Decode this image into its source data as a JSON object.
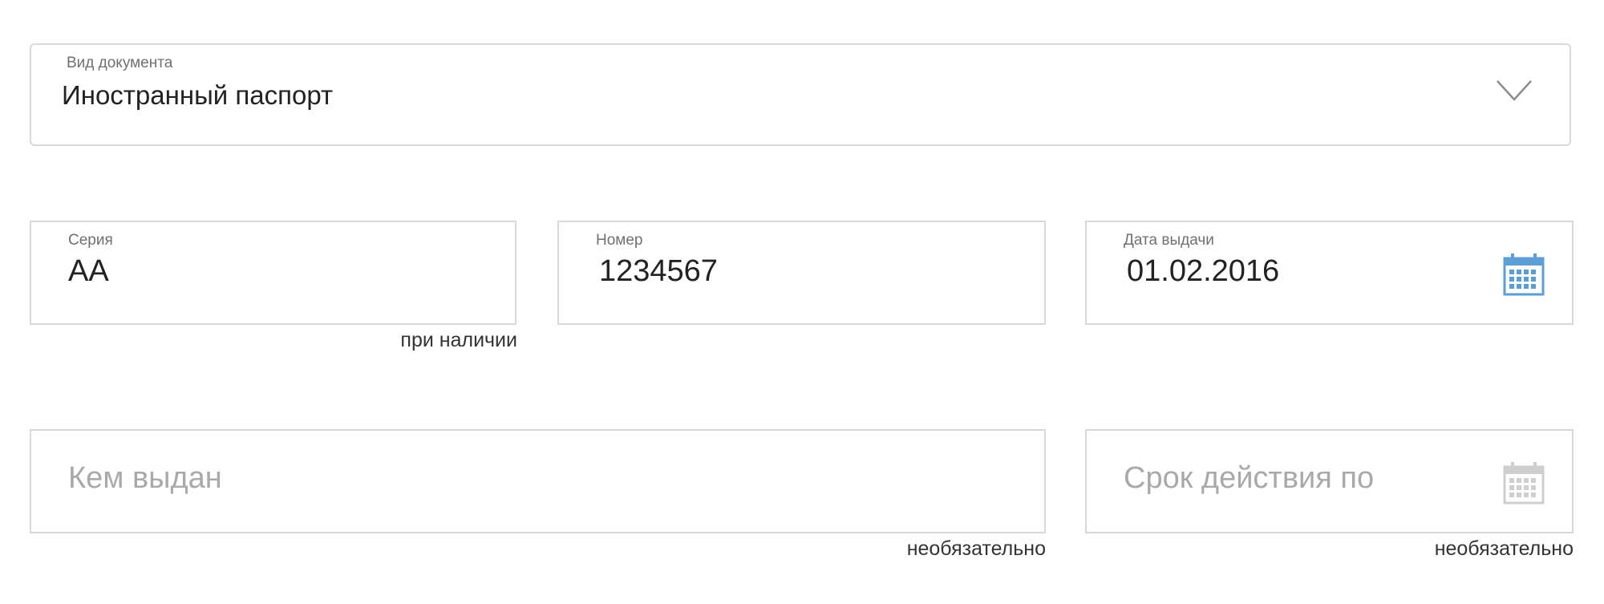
{
  "document_type": {
    "label": "Вид документа",
    "value": "Иностранный паспорт",
    "icon": "chevron-down-icon"
  },
  "series": {
    "label": "Серия",
    "value": "АА",
    "hint": "при наличии"
  },
  "number": {
    "label": "Номер",
    "value": "1234567"
  },
  "issue_date": {
    "label": "Дата выдачи",
    "value": "01.02.2016",
    "icon": "calendar-icon"
  },
  "issued_by": {
    "placeholder": "Кем выдан",
    "hint": "необязательно"
  },
  "valid_until": {
    "placeholder": "Срок действия по",
    "hint": "необязательно",
    "icon": "calendar-icon"
  },
  "colors": {
    "calendar_active": "#5b9fd6",
    "calendar_inactive": "#cfcfcf",
    "border": "#d9d9d9",
    "placeholder": "#a9a9a9"
  }
}
